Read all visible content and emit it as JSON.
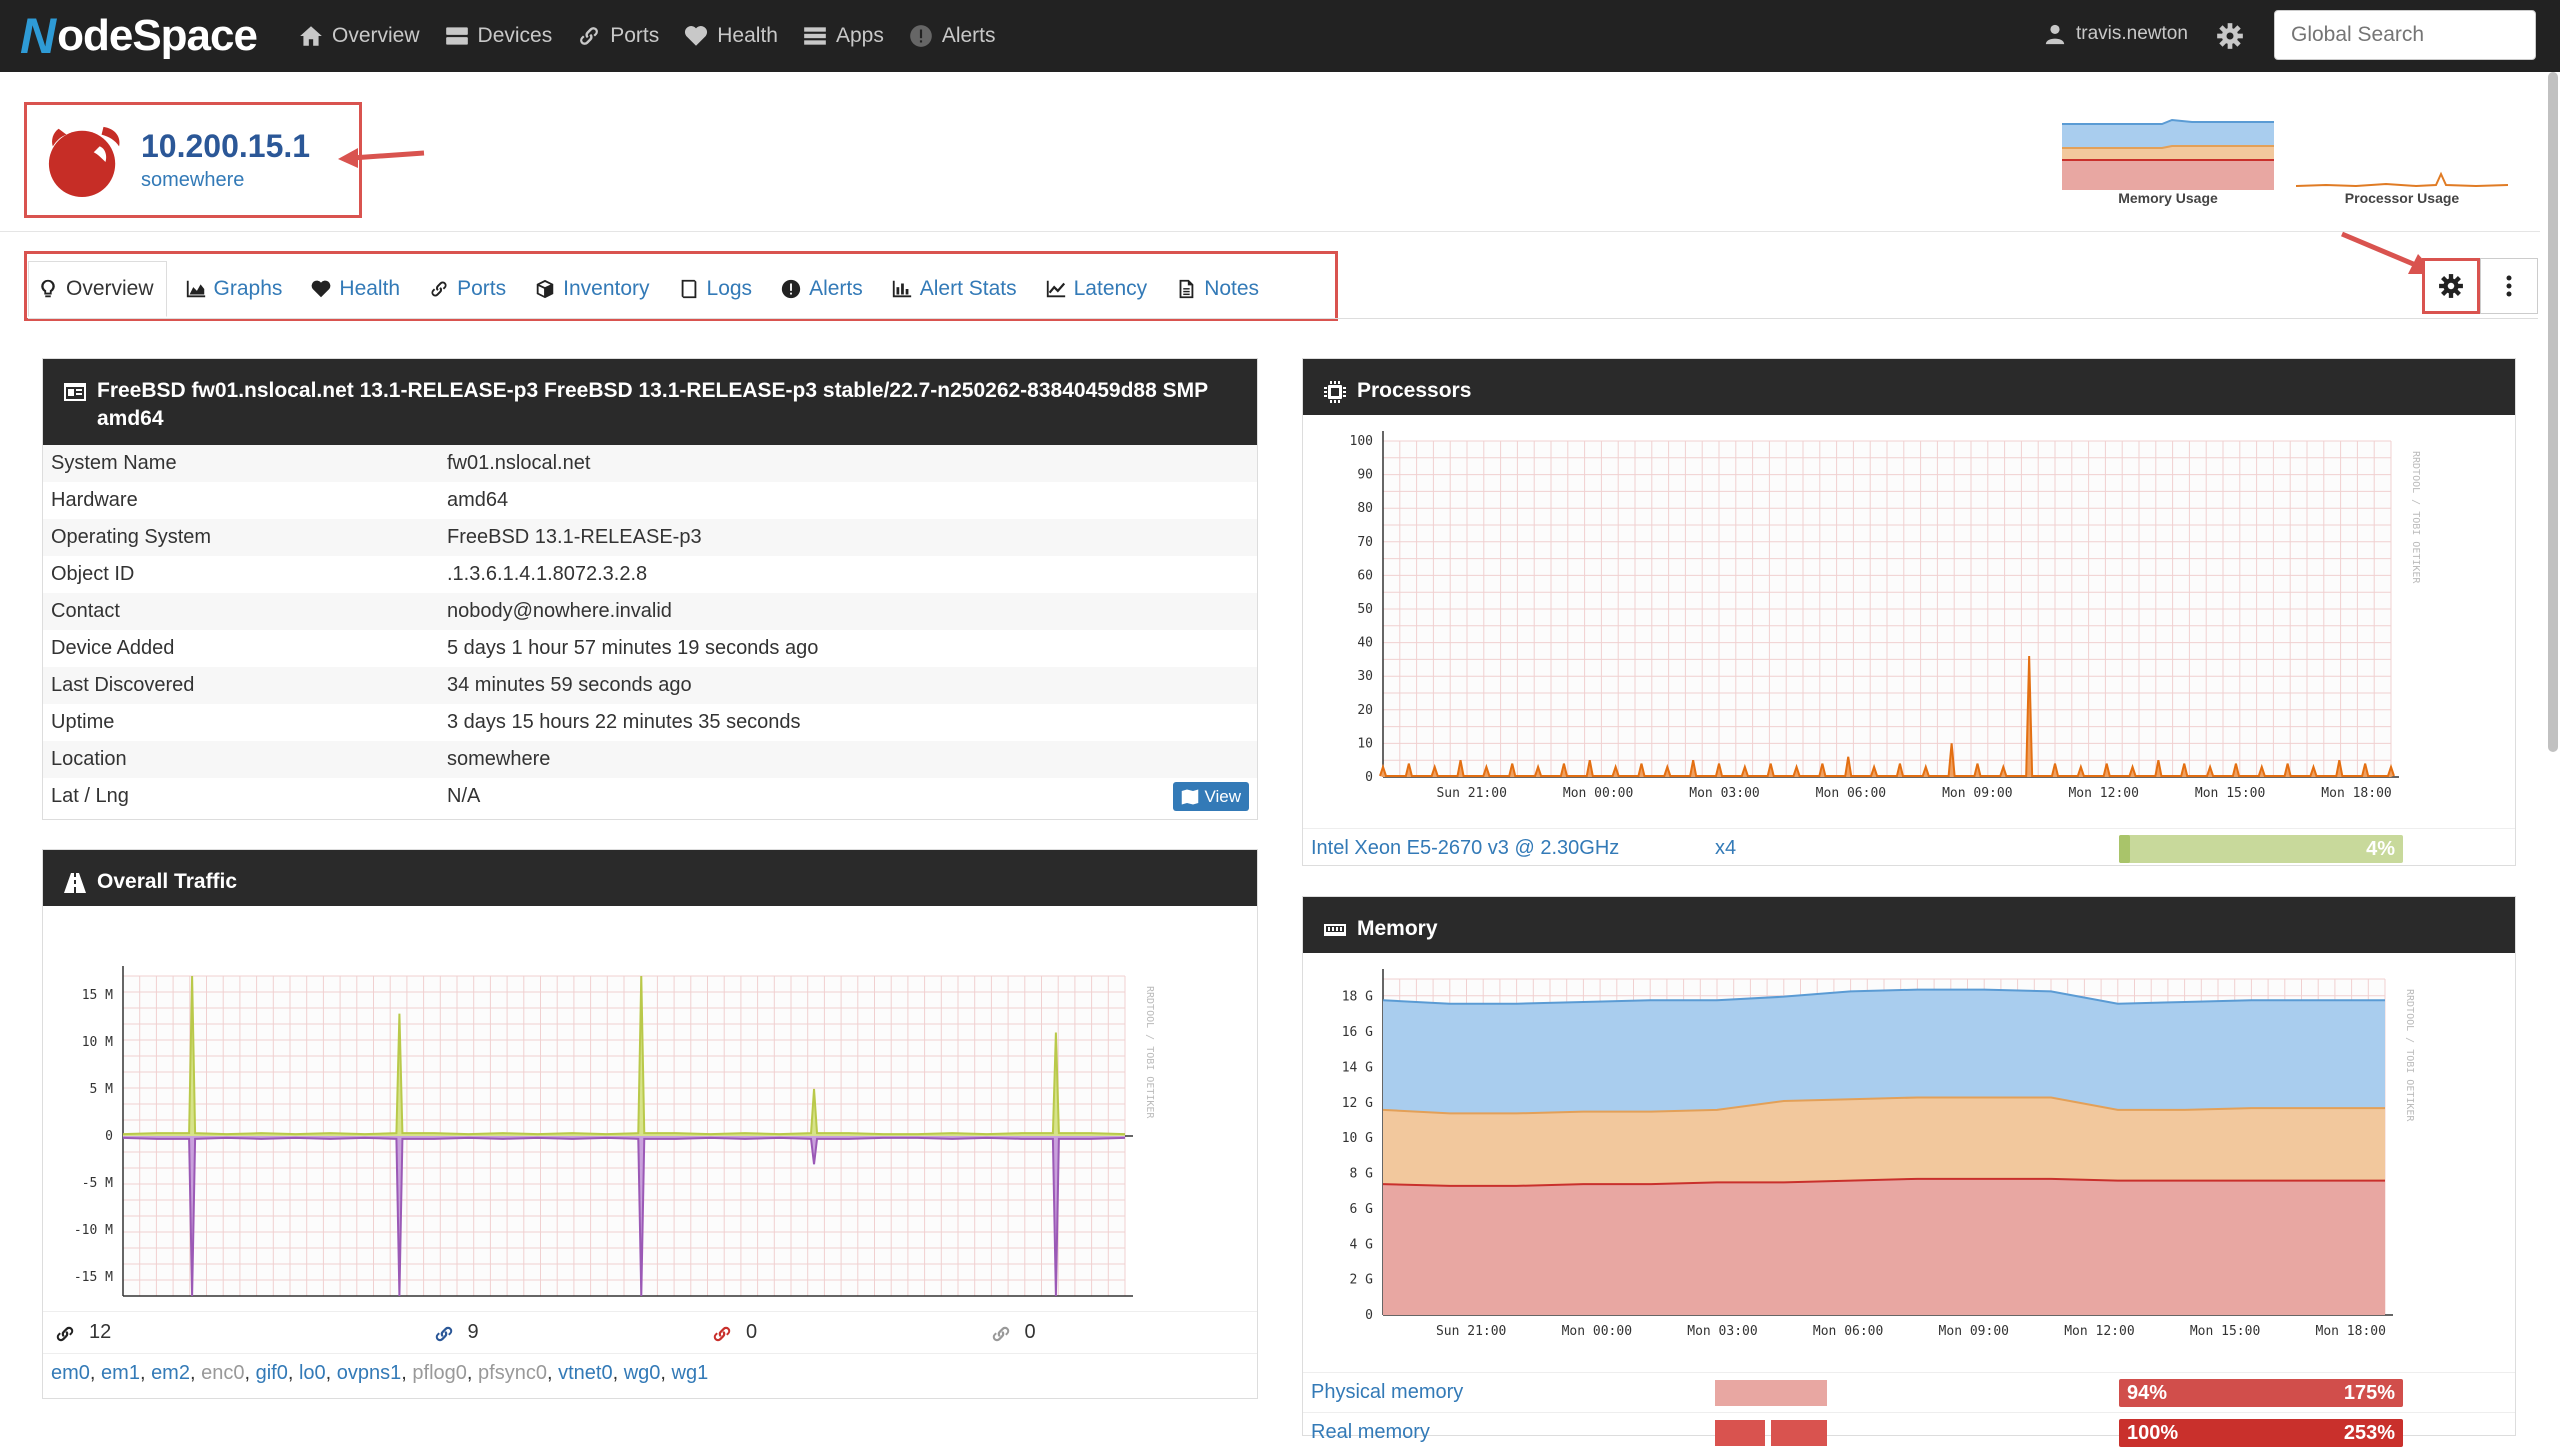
{
  "nav": {
    "brand": "NodeSpace",
    "items": [
      {
        "label": "Overview",
        "icon": "home-icon"
      },
      {
        "label": "Devices",
        "icon": "server-icon"
      },
      {
        "label": "Ports",
        "icon": "link-icon"
      },
      {
        "label": "Health",
        "icon": "heartbeat-icon"
      },
      {
        "label": "Apps",
        "icon": "tasks-icon"
      },
      {
        "label": "Alerts",
        "icon": "exclamation-circle-icon"
      }
    ],
    "user": "travis.newton",
    "search_placeholder": "Global Search"
  },
  "device": {
    "ip": "10.200.15.1",
    "location": "somewhere",
    "mini_graphs": [
      "Memory Usage",
      "Processor Usage"
    ]
  },
  "tabs": [
    {
      "label": "Overview",
      "icon": "lightbulb-icon"
    },
    {
      "label": "Graphs",
      "icon": "area-chart-icon"
    },
    {
      "label": "Health",
      "icon": "heartbeat-icon"
    },
    {
      "label": "Ports",
      "icon": "link-icon"
    },
    {
      "label": "Inventory",
      "icon": "cube-icon"
    },
    {
      "label": "Logs",
      "icon": "book-icon"
    },
    {
      "label": "Alerts",
      "icon": "exclamation-circle-icon"
    },
    {
      "label": "Alert Stats",
      "icon": "bar-chart-icon"
    },
    {
      "label": "Latency",
      "icon": "line-chart-icon"
    },
    {
      "label": "Notes",
      "icon": "file-text-icon"
    }
  ],
  "overview": {
    "title": "FreeBSD fw01.nslocal.net 13.1-RELEASE-p3 FreeBSD 13.1-RELEASE-p3 stable/22.7-n250262-83840459d88 SMP amd64",
    "rows": [
      {
        "k": "System Name",
        "v": "fw01.nslocal.net"
      },
      {
        "k": "Hardware",
        "v": "amd64"
      },
      {
        "k": "Operating System",
        "v": "FreeBSD 13.1-RELEASE-p3"
      },
      {
        "k": "Object ID",
        "v": ".1.3.6.1.4.1.8072.3.2.8"
      },
      {
        "k": "Contact",
        "v": "nobody@nowhere.invalid"
      },
      {
        "k": "Device Added",
        "v": "5 days 1 hour 57 minutes 19 seconds ago"
      },
      {
        "k": "Last Discovered",
        "v": "34 minutes 59 seconds ago"
      },
      {
        "k": "Uptime",
        "v": "3 days 15 hours 22 minutes 35 seconds"
      },
      {
        "k": "Location",
        "v": "somewhere"
      },
      {
        "k": "Lat / Lng",
        "v": "N/A"
      }
    ],
    "view_label": "View"
  },
  "traffic": {
    "title": "Overall Traffic",
    "port_counts": [
      "12",
      "9",
      "0",
      "0"
    ],
    "interfaces": [
      {
        "name": "em0",
        "on": true
      },
      {
        "name": "em1",
        "on": true
      },
      {
        "name": "em2",
        "on": true
      },
      {
        "name": "enc0",
        "on": false
      },
      {
        "name": "gif0",
        "on": true
      },
      {
        "name": "lo0",
        "on": true
      },
      {
        "name": "ovpns1",
        "on": true
      },
      {
        "name": "pflog0",
        "on": false
      },
      {
        "name": "pfsync0",
        "on": false
      },
      {
        "name": "vtnet0",
        "on": true
      },
      {
        "name": "wg0",
        "on": true
      },
      {
        "name": "wg1",
        "on": true
      }
    ]
  },
  "processors": {
    "title": "Processors",
    "cpu_name": "Intel Xeon E5-2670 v3 @ 2.30GHz",
    "count": "x4",
    "usage_label": "4%",
    "usage_fraction": 0.04
  },
  "memory": {
    "title": "Memory",
    "rows": [
      {
        "name": "Physical memory",
        "pct": "94%",
        "pct2": "175%"
      },
      {
        "name": "Real memory",
        "pct": "100%",
        "pct2": "253%"
      }
    ]
  },
  "chart_data": [
    {
      "type": "area",
      "title": "",
      "yticks": [
        "15 M",
        "10 M",
        "5 M",
        "0",
        "-5 M",
        "-10 M",
        "-15 M"
      ],
      "xticks": [
        "Sun 21:00",
        "Mon 00:00",
        "Mon 03:00",
        "Mon 06:00",
        "Mon 09:00",
        "Mon 12:00",
        "Mon 15:00",
        "Mon 18:00"
      ],
      "series": [
        {
          "values": [
            0.2,
            0.3,
            17,
            0.2,
            0.3,
            0.2,
            0.3,
            0.2,
            13,
            0.3,
            0.2,
            0.3,
            0.2,
            0.3,
            0.2,
            17,
            0.3,
            0.2,
            0.3,
            0.2,
            5,
            0.3,
            0.2,
            0.2,
            0.3,
            0.2,
            0.3,
            11,
            0.3,
            0.2
          ]
        },
        {
          "values": [
            -0.2,
            -0.3,
            -17,
            -0.2,
            -0.3,
            -0.2,
            -0.3,
            -0.2,
            -17,
            -0.3,
            -0.2,
            -0.3,
            -0.2,
            -0.3,
            -0.2,
            -17,
            -0.3,
            -0.2,
            -0.3,
            -0.2,
            -3,
            -0.3,
            -0.2,
            -0.2,
            -0.3,
            -0.2,
            -0.3,
            -17,
            -0.3,
            -0.2
          ]
        }
      ],
      "ylim": [
        -17,
        17
      ],
      "grid": true
    },
    {
      "type": "area",
      "title": "",
      "yticks": [
        "100",
        "90",
        "80",
        "70",
        "60",
        "50",
        "40",
        "30",
        "20",
        "10",
        "0"
      ],
      "xticks": [
        "Sun 21:00",
        "Mon 00:00",
        "Mon 03:00",
        "Mon 06:00",
        "Mon 09:00",
        "Mon 12:00",
        "Mon 15:00",
        "Mon 18:00"
      ],
      "series": [
        {
          "values": [
            3,
            4,
            3,
            5,
            3,
            4,
            3,
            4,
            5,
            3,
            4,
            3,
            5,
            4,
            3,
            4,
            3,
            4,
            6,
            3,
            4,
            3,
            10,
            4,
            3,
            36,
            4,
            3,
            4,
            3,
            5,
            4,
            3,
            4,
            3,
            4,
            3,
            5,
            4,
            3
          ]
        }
      ],
      "ylim": [
        0,
        100
      ],
      "grid": true
    },
    {
      "type": "area",
      "title": "",
      "yticks": [
        "18 G",
        "16 G",
        "14 G",
        "12 G",
        "10 G",
        "8 G",
        "6 G",
        "4 G",
        "2 G",
        "0"
      ],
      "xticks": [
        "Sun 21:00",
        "Mon 00:00",
        "Mon 03:00",
        "Mon 06:00",
        "Mon 09:00",
        "Mon 12:00",
        "Mon 15:00",
        "Mon 18:00"
      ],
      "series": [
        {
          "values": [
            7.4,
            7.3,
            7.3,
            7.4,
            7.4,
            7.5,
            7.5,
            7.6,
            7.7,
            7.7,
            7.7,
            7.6,
            7.6,
            7.6,
            7.6,
            7.6
          ]
        },
        {
          "values": [
            11.6,
            11.4,
            11.4,
            11.5,
            11.5,
            11.6,
            12.1,
            12.2,
            12.3,
            12.3,
            12.3,
            11.6,
            11.6,
            11.7,
            11.7,
            11.7
          ]
        },
        {
          "values": [
            17.8,
            17.6,
            17.6,
            17.7,
            17.8,
            17.8,
            18.0,
            18.3,
            18.4,
            18.4,
            18.3,
            17.6,
            17.7,
            17.8,
            17.8,
            17.8
          ]
        }
      ],
      "ylim": [
        0,
        19
      ],
      "grid": true
    }
  ]
}
